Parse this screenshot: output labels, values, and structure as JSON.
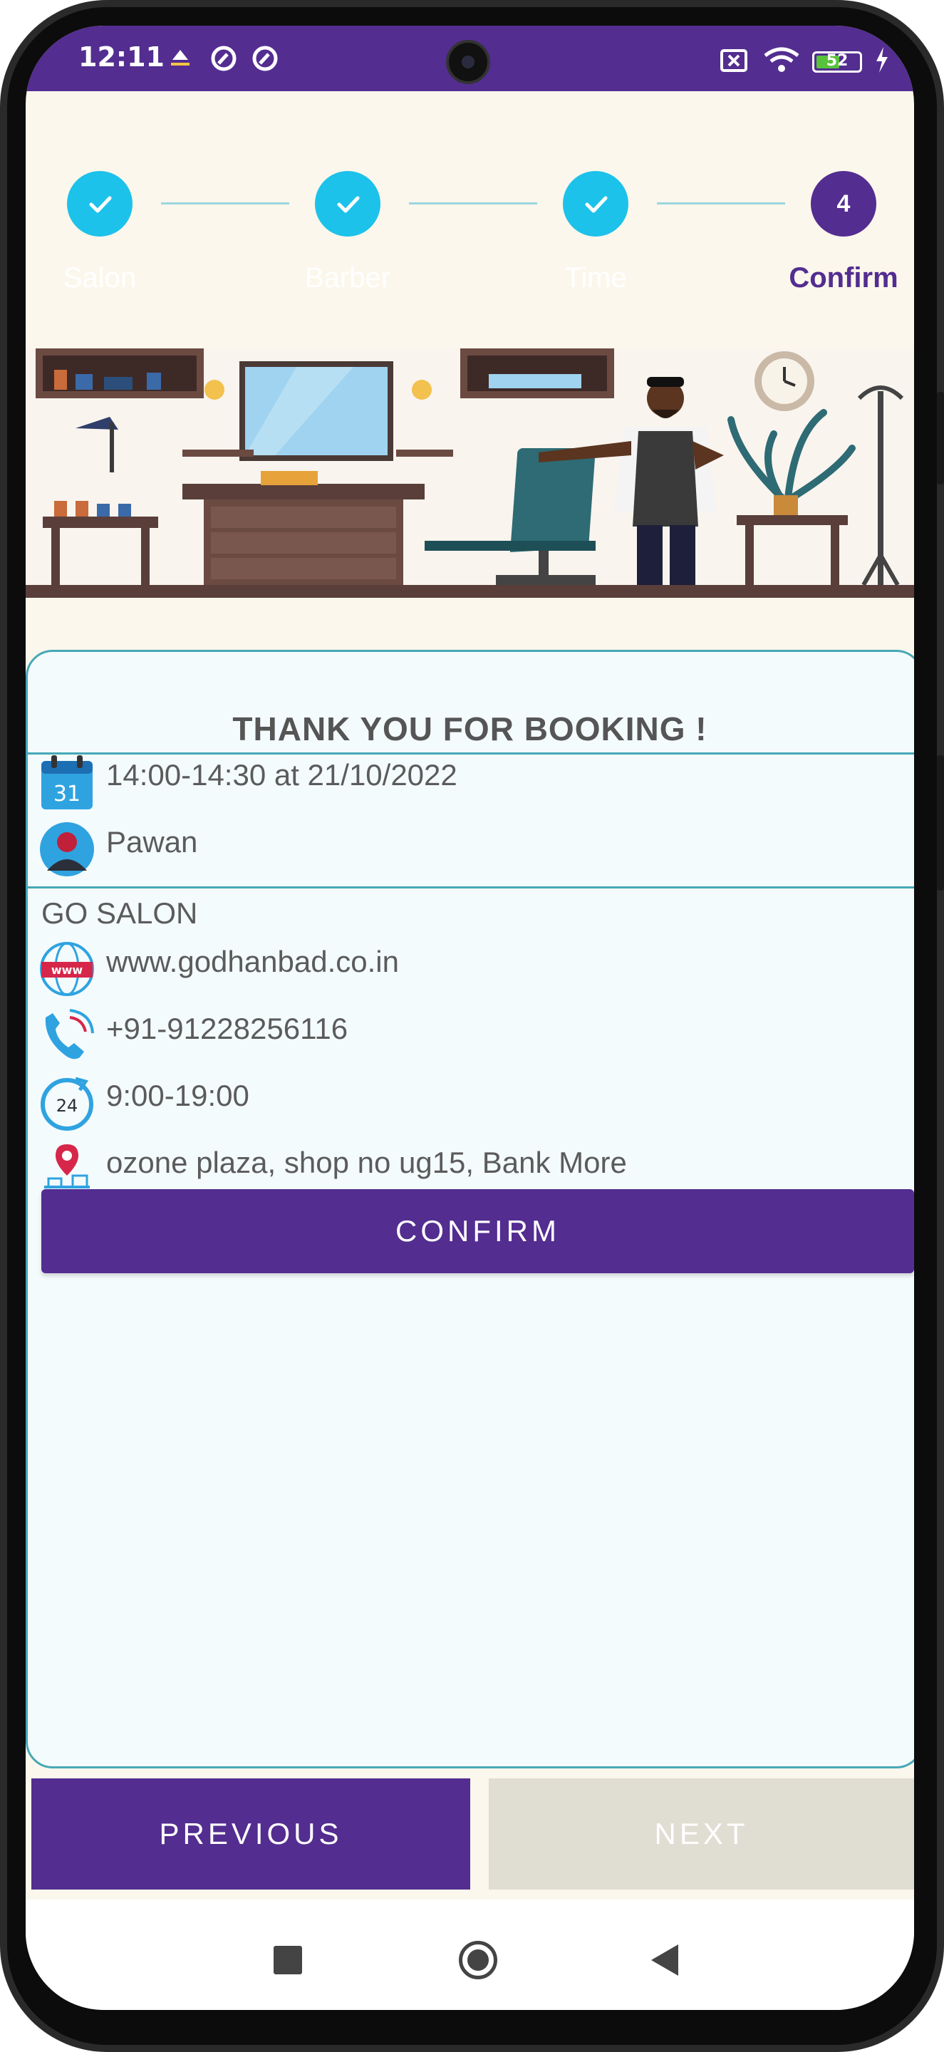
{
  "status_bar": {
    "time": "12:11",
    "battery": "52",
    "icons": [
      "notification-app-icon",
      "sync-icon",
      "sync-icon",
      "no-sim-icon",
      "wifi-icon",
      "battery-icon",
      "charging-icon"
    ]
  },
  "stepper": {
    "steps": [
      {
        "label": "Salon",
        "state": "done"
      },
      {
        "label": "Barber",
        "state": "done"
      },
      {
        "label": "Time",
        "state": "done"
      },
      {
        "label": "Confirm",
        "state": "active",
        "number": "4"
      }
    ]
  },
  "booking": {
    "title": "THANK YOU FOR BOOKING !",
    "datetime": "14:00-14:30 at 21/10/2022",
    "calendar_day": "31",
    "barber": "Pawan",
    "salon_name": "GO SALON",
    "website": "www.godhanbad.co.in",
    "website_icon_text": "www",
    "phone": "+91-91228256116",
    "hours": "9:00-19:00",
    "clock_icon_text": "24",
    "address": "ozone plaza, shop no ug15, Bank More",
    "confirm_label": "CONFIRM"
  },
  "footer": {
    "previous_label": "PREVIOUS",
    "next_label": "NEXT"
  },
  "colors": {
    "primary": "#532d90",
    "step_done": "#1cc2ea",
    "card_border": "#46a8b6",
    "card_bg": "#f4fbfd",
    "page_bg": "#fcf7ec",
    "next_disabled": "#e0ddd3"
  }
}
